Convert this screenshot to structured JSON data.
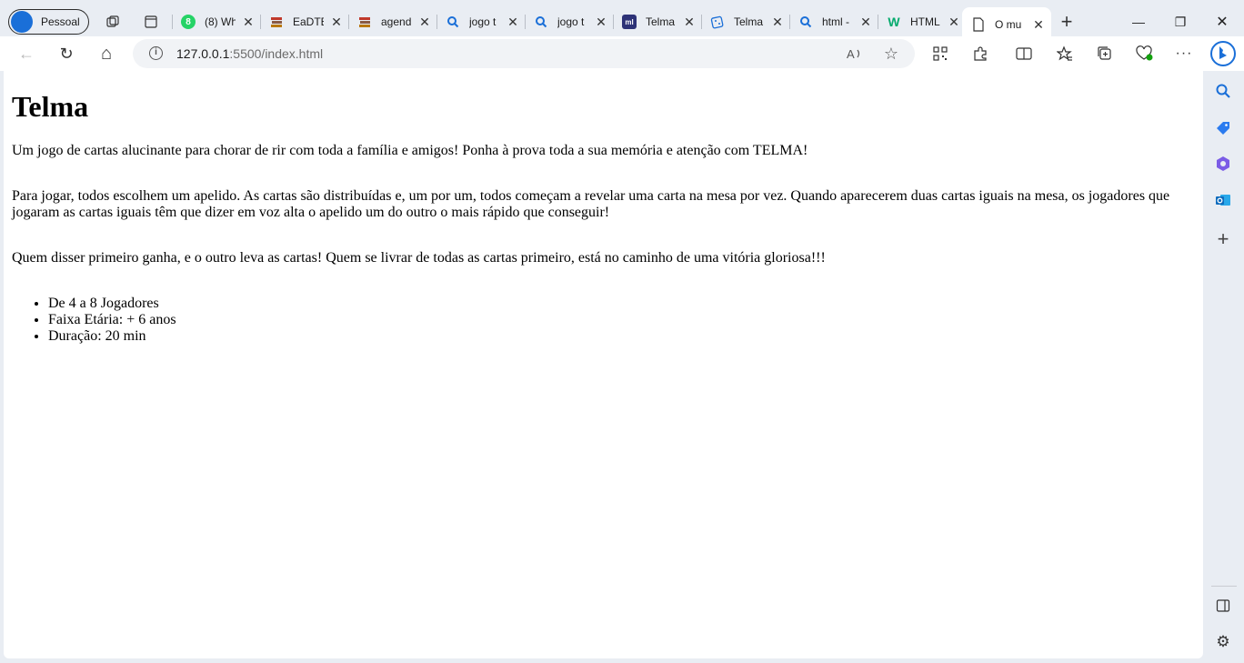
{
  "browser": {
    "profile_name": "Pessoal",
    "tabs": [
      {
        "title": "(8) Wh",
        "icon": "whatsapp-icon",
        "color": "#25d366"
      },
      {
        "title": "EaDTE",
        "icon": "book-stack-icon",
        "color": "#8a5a44"
      },
      {
        "title": "agend",
        "icon": "book-stack-icon",
        "color": "#8a5a44"
      },
      {
        "title": "jogo t",
        "icon": "search-icon",
        "color": "#1a6fd8"
      },
      {
        "title": "jogo t",
        "icon": "search-icon",
        "color": "#1a6fd8"
      },
      {
        "title": "Telma",
        "icon": "ml-icon",
        "color": "#2d3277"
      },
      {
        "title": "Telma",
        "icon": "dice-icon",
        "color": "#1a6fd8"
      },
      {
        "title": "html -",
        "icon": "search-icon",
        "color": "#1a6fd8"
      },
      {
        "title": "HTML",
        "icon": "w3schools-icon",
        "color": "#04aa6d"
      },
      {
        "title": "O mu",
        "icon": "page-icon",
        "color": "#333333"
      }
    ],
    "active_tab_index": 9,
    "address": {
      "host": "127.0.0.1",
      "rest": ":5500/index.html"
    },
    "glyphs": {
      "close": "✕",
      "plus": "+",
      "back": "←",
      "reload": "↻",
      "home": "⌂",
      "minimize": "—",
      "restore": "❐",
      "window_close": "✕",
      "info": "i"
    }
  },
  "page": {
    "heading": "Telma",
    "paragraph1": "Um jogo de cartas alucinante para chorar de rir com toda a família e amigos! Ponha à prova toda a sua memória e atenção com TELMA!",
    "paragraph2": "Para jogar, todos escolhem um apelido. As cartas são distribuídas e, um por um, todos começam a revelar uma carta na mesa por vez. Quando aparecerem duas cartas iguais na mesa, os jogadores que jogaram as cartas iguais têm que dizer em voz alta o apelido um do outro o mais rápido que conseguir!",
    "paragraph3": "Quem disser primeiro ganha, e o outro leva as cartas! Quem se livrar de todas as cartas primeiro, está no caminho de uma vitória gloriosa!!!",
    "list": [
      "De 4 a 8 Jogadores",
      "Faixa Etária: + 6 anos",
      "Duração: 20 min"
    ]
  }
}
